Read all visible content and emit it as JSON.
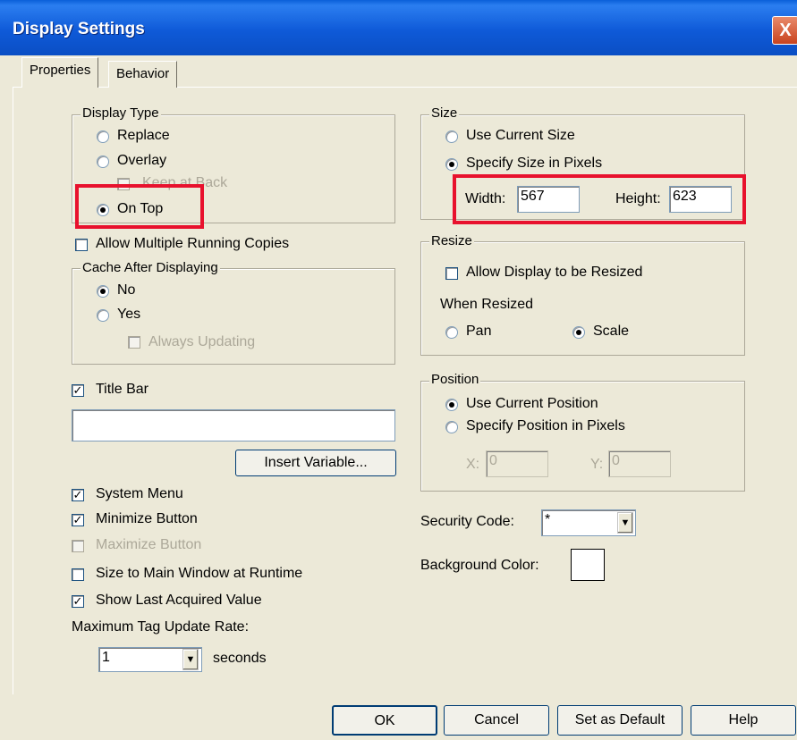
{
  "window": {
    "title": "Display Settings",
    "close_glyph": "X"
  },
  "tabs": [
    {
      "label": "Properties",
      "active": true
    },
    {
      "label": "Behavior",
      "active": false
    }
  ],
  "display_type": {
    "legend": "Display Type",
    "options": [
      "Replace",
      "Overlay",
      "On Top"
    ],
    "selected": "On Top",
    "keep_at_back": "Keep at Back"
  },
  "allow_multiple": {
    "label": "Allow Multiple Running Copies",
    "checked": false
  },
  "cache": {
    "legend": "Cache After Displaying",
    "options": [
      "No",
      "Yes"
    ],
    "selected": "No",
    "always_updating": "Always Updating"
  },
  "title_bar": {
    "label": "Title Bar",
    "checked": true,
    "value": ""
  },
  "insert_variable": "Insert Variable...",
  "checkboxes": [
    {
      "label": "System Menu",
      "checked": true,
      "enabled": true
    },
    {
      "label": "Minimize Button",
      "checked": true,
      "enabled": true
    },
    {
      "label": "Maximize Button",
      "checked": false,
      "enabled": false
    },
    {
      "label": "Size to Main Window at Runtime",
      "checked": false,
      "enabled": true
    },
    {
      "label": "Show Last Acquired Value",
      "checked": true,
      "enabled": true
    }
  ],
  "update_rate": {
    "label": "Maximum Tag Update Rate:",
    "value": "1",
    "unit": "seconds"
  },
  "size": {
    "legend": "Size",
    "options": [
      "Use Current Size",
      "Specify Size in Pixels"
    ],
    "selected": "Specify Size in Pixels",
    "width_label": "Width:",
    "width_value": "567",
    "height_label": "Height:",
    "height_value": "623"
  },
  "resize": {
    "legend": "Resize",
    "allow_label": "Allow Display to be Resized",
    "when_resized": "When Resized",
    "options": [
      "Pan",
      "Scale"
    ],
    "selected": "Scale"
  },
  "position": {
    "legend": "Position",
    "options": [
      "Use Current Position",
      "Specify Position in Pixels"
    ],
    "selected": "Use Current Position",
    "x_label": "X:",
    "x_value": "0",
    "y_label": "Y:",
    "y_value": "0"
  },
  "security": {
    "label": "Security Code:",
    "value": "*"
  },
  "background": {
    "label": "Background Color:",
    "color": "#ffffff"
  },
  "buttons": {
    "ok": "OK",
    "cancel": "Cancel",
    "set_default": "Set as Default",
    "help": "Help"
  },
  "highlight_color": "#e8112d"
}
